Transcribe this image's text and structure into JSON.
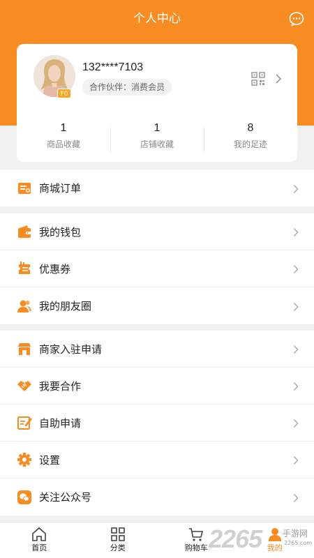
{
  "header": {
    "title": "个人中心",
    "message_icon": "chat-bubble-icon"
  },
  "profile": {
    "phone": "132****7103",
    "role_tag": "合作伙伴：消费会员",
    "level_badge": "F0",
    "qr_icon": "qr-code-icon"
  },
  "stats": [
    {
      "value": "1",
      "label": "商品收藏"
    },
    {
      "value": "1",
      "label": "店铺收藏"
    },
    {
      "value": "8",
      "label": "我的足迹"
    }
  ],
  "menu_groups": [
    {
      "items": [
        {
          "label": "商城订单",
          "icon": "order-icon"
        }
      ]
    },
    {
      "items": [
        {
          "label": "我的钱包",
          "icon": "wallet-icon"
        },
        {
          "label": "优惠券",
          "icon": "coupon-icon"
        },
        {
          "label": "我的朋友圈",
          "icon": "friends-icon"
        }
      ]
    },
    {
      "items": [
        {
          "label": "商家入驻申请",
          "icon": "store-icon"
        },
        {
          "label": "我要合作",
          "icon": "handshake-icon"
        },
        {
          "label": "自助申请",
          "icon": "edit-form-icon"
        },
        {
          "label": "设置",
          "icon": "gear-icon"
        },
        {
          "label": "关注公众号",
          "icon": "wechat-icon"
        }
      ]
    }
  ],
  "tabbar": [
    {
      "label": "首页",
      "icon": "home-icon",
      "active": false
    },
    {
      "label": "分类",
      "icon": "grid-icon",
      "active": false
    },
    {
      "label": "购物车",
      "icon": "cart-icon",
      "active": false
    },
    {
      "label": "我的",
      "icon": "user-icon",
      "active": true
    }
  ],
  "watermark": {
    "number": "2265",
    "text": "手游网",
    "url": "2265.com"
  },
  "colors": {
    "accent": "#f78c22",
    "background": "#f1f1f1"
  }
}
